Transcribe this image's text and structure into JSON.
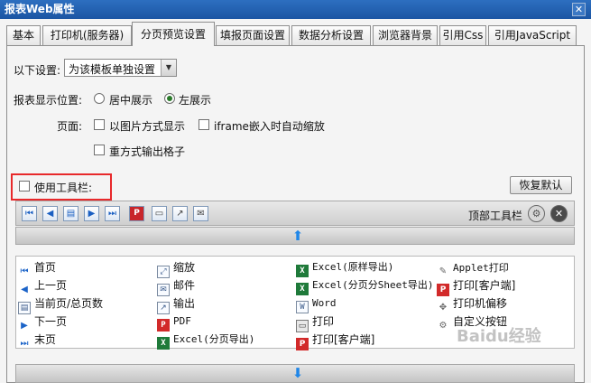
{
  "window": {
    "title": "报表Web属性",
    "close_glyph": "✕"
  },
  "tabs": [
    {
      "label": "基本"
    },
    {
      "label": "打印机(服务器)"
    },
    {
      "label": "分页预览设置"
    },
    {
      "label": "填报页面设置"
    },
    {
      "label": "数据分析设置"
    },
    {
      "label": "浏览器背景"
    },
    {
      "label": "引用Css"
    },
    {
      "label": "引用JavaScript"
    }
  ],
  "active_tab": 2,
  "settings": {
    "scope_label": "以下设置:",
    "scope_value": "为该模板单独设置",
    "position_label": "报表显示位置:",
    "position_center": "居中展示",
    "position_left": "左展示",
    "position_selected": "left",
    "page_label": "页面:",
    "page_as_image": "以图片方式显示",
    "iframe_autoscale": "iframe嵌入时自动缩放",
    "repeat_grid": "重方式输出格子",
    "use_toolbar": "使用工具栏:"
  },
  "toolbar": {
    "restore_default": "恢复默认",
    "top_toolbar_label": "顶部工具栏",
    "icons": [
      "first-page-icon",
      "prev-page-icon",
      "page-number-icon",
      "next-page-icon",
      "last-page-icon",
      "pdf-icon",
      "print-icon",
      "export-icon",
      "email-icon"
    ]
  },
  "buttons_grid": {
    "col1": [
      {
        "label": "首页",
        "icon": "first-page-icon"
      },
      {
        "label": "上一页",
        "icon": "prev-page-icon"
      },
      {
        "label": "当前页/总页数",
        "icon": "page-number-icon"
      },
      {
        "label": "下一页",
        "icon": "next-page-icon"
      },
      {
        "label": "末页",
        "icon": "last-page-icon"
      }
    ],
    "col2": [
      {
        "label": "缩放",
        "icon": "zoom-icon"
      },
      {
        "label": "邮件",
        "icon": "email-icon"
      },
      {
        "label": "输出",
        "icon": "output-icon"
      },
      {
        "label": "PDF",
        "icon": "pdf-icon"
      },
      {
        "label": "Excel(分页导出)",
        "icon": "excel-icon"
      }
    ],
    "col3": [
      {
        "label": "Excel(原样导出)",
        "icon": "excel-icon"
      },
      {
        "label": "Excel(分页分Sheet导出)",
        "icon": "excel-icon"
      },
      {
        "label": "Word",
        "icon": "word-icon"
      },
      {
        "label": "打印",
        "icon": "print-icon"
      },
      {
        "label": "打印[客户端]",
        "icon": "client-print-icon"
      }
    ],
    "col4": [
      {
        "label": "Applet打印",
        "icon": "applet-print-icon"
      },
      {
        "label": "打印[客户端]",
        "icon": "pdf-print-icon"
      },
      {
        "label": "打印机偏移",
        "icon": "printer-offset-icon"
      },
      {
        "label": "自定义按钮",
        "icon": "custom-button-icon"
      }
    ]
  },
  "watermark": "Baidu经验"
}
